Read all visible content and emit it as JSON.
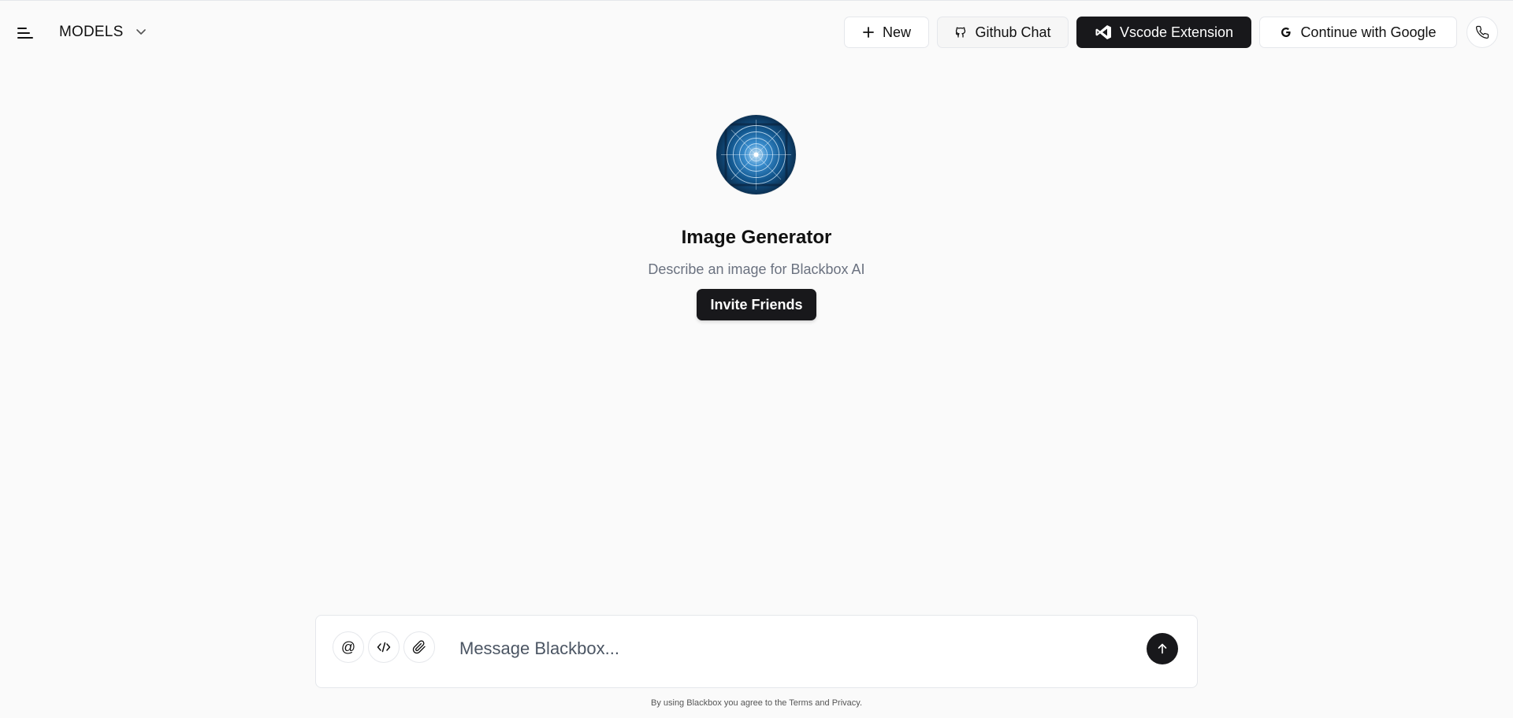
{
  "header": {
    "models_label": "MODELS",
    "buttons": {
      "new": "New",
      "github": "Github Chat",
      "vscode": "Vscode Extension",
      "google": "Continue with Google"
    }
  },
  "hero": {
    "title": "Image Generator",
    "subtitle": "Describe an image for Blackbox AI",
    "invite": "Invite Friends"
  },
  "composer": {
    "at_symbol": "@",
    "placeholder": "Message Blackbox..."
  },
  "footer": {
    "prefix": "By using Blackbox you agree to the ",
    "terms": "Terms",
    "and": " and ",
    "privacy": "Privacy",
    "suffix": "."
  },
  "colors": {
    "background": "#fafafa",
    "dark": "#18181b",
    "border": "#e5e7eb",
    "muted": "#6b7280"
  },
  "icons": [
    "menu-icon",
    "chevron-down-icon",
    "plus-icon",
    "github-icon",
    "vscode-icon",
    "google-icon",
    "phone-icon",
    "code-icon",
    "paperclip-icon",
    "arrow-up-icon"
  ]
}
